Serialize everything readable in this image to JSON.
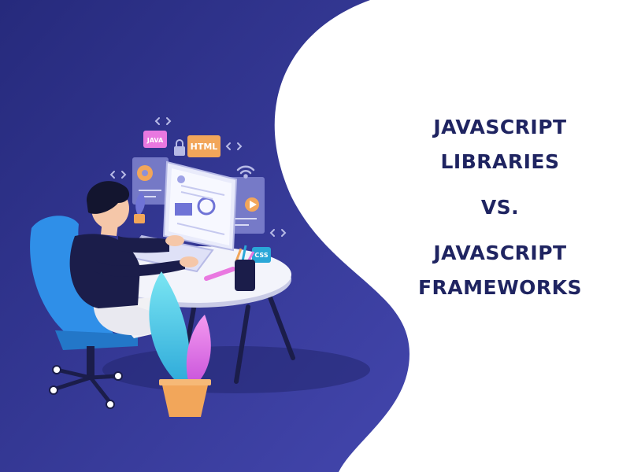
{
  "headline": {
    "line1": "JAVASCRIPT",
    "line2": "LIBRARIES",
    "vs": "VS.",
    "line3": "JAVASCRIPT",
    "line4": "FRAMEWORKS"
  },
  "labels": {
    "java": "JAVA",
    "html": "HTML",
    "css": "CSS"
  },
  "colors": {
    "bg_dark": "#2b2f86",
    "bg_mid": "#3c3fa2",
    "headline": "#1f2461",
    "chair": "#2f8fe8",
    "leaf_cyan": "#3fc9e6",
    "leaf_pink": "#e866e0",
    "pot": "#f2a65a"
  },
  "icons": [
    "code-icon",
    "lock-icon",
    "wifi-icon",
    "gear-icon",
    "play-icon",
    "cloud-icon"
  ]
}
